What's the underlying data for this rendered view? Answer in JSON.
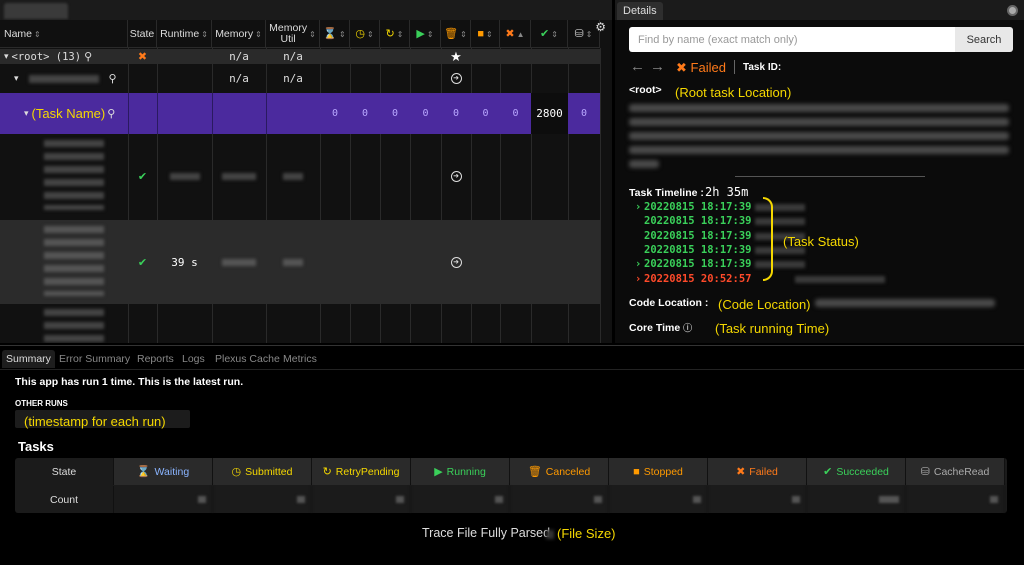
{
  "tree": {
    "columns": [
      {
        "label": "Name",
        "sort": "⇕"
      },
      {
        "label": "State",
        "sort": ""
      },
      {
        "label": "Runtime",
        "sort": "⇕"
      },
      {
        "label": "Memory",
        "sort": "⇕"
      },
      {
        "label": "Memory Util",
        "sort": "⇕"
      },
      {
        "icon": "hourglass-icon",
        "glyph": "⌛",
        "color": "#8ab4ff",
        "sort": "⇕"
      },
      {
        "icon": "clock-icon",
        "glyph": "◷",
        "color": "#f5d800",
        "sort": "⇕"
      },
      {
        "icon": "retry-icon",
        "glyph": "↻",
        "color": "#f5d800",
        "sort": "⇕"
      },
      {
        "icon": "play-icon",
        "glyph": "▶",
        "color": "#3ad05a",
        "sort": "⇕"
      },
      {
        "icon": "trash-icon",
        "glyph": "🗑",
        "color": "#ff9a00",
        "sort": "⇕"
      },
      {
        "icon": "stop-icon",
        "glyph": "■",
        "color": "#ff9a00",
        "sort": "⇕"
      },
      {
        "icon": "x-icon",
        "glyph": "✖",
        "color": "#ff7a1a",
        "sort": "▲"
      },
      {
        "icon": "check-icon",
        "glyph": "✔",
        "color": "#3ad05a",
        "sort": "⇕"
      },
      {
        "icon": "database-icon",
        "glyph": "⛁",
        "color": "#cccccc",
        "sort": "⇕"
      }
    ],
    "root": {
      "label": "<root> (13)",
      "memory": "",
      "memory_util": "n/a",
      "memory_val": "n/a"
    },
    "executor": {
      "memory": "n/a",
      "memory_util": "n/a"
    },
    "selected": {
      "annotation": "(Task Name)",
      "counts": [
        "0",
        "0",
        "0",
        "0",
        "0",
        "0",
        "0",
        "2800",
        "0"
      ]
    },
    "task_row_2": {
      "runtime": "39 s"
    }
  },
  "details": {
    "tab_label": "Details",
    "search_placeholder": "Find by name (exact match only)",
    "search_button": "Search",
    "status": "Failed",
    "task_id_label": "Task ID:",
    "root_label": "<root>",
    "root_annotation": "(Root task Location)",
    "timeline_label": "Task Timeline :",
    "timeline_duration": "2h 35m",
    "timeline": [
      {
        "arrow": "›",
        "time": "20220815 18:17:39",
        "color": "#3ad05a"
      },
      {
        "arrow": "",
        "time": "20220815 18:17:39",
        "color": "#3ad05a"
      },
      {
        "arrow": "",
        "time": "20220815 18:17:39",
        "color": "#3ad05a"
      },
      {
        "arrow": "",
        "time": "20220815 18:17:39",
        "color": "#3ad05a"
      },
      {
        "arrow": "›",
        "time": "20220815 18:17:39",
        "color": "#3ad05a"
      },
      {
        "arrow": "›",
        "time": "20220815 20:52:57",
        "color": "#ff4a2a"
      }
    ],
    "status_annotation": "(Task Status)",
    "code_location_label": "Code Location :",
    "code_location_annotation": "(Code Location)",
    "core_time_label": "Core Time",
    "core_time_annotation": "(Task running Time)"
  },
  "bottom": {
    "tabs": [
      "Summary",
      "Error Summary",
      "Reports",
      "Logs",
      "Plexus Cache",
      "Metrics"
    ],
    "run_message": "This app has run 1 time. This is the latest run.",
    "other_runs_label": "OTHER RUNS",
    "run_timestamp_annotation": "(timestamp for each run)",
    "tasks_title": "Tasks",
    "state_label": "State",
    "count_label": "Count",
    "states": [
      {
        "label": "Waiting",
        "icon": "hourglass-icon",
        "glyph": "⌛",
        "color": "#8ab4ff"
      },
      {
        "label": "Submitted",
        "icon": "clock-icon",
        "glyph": "◷",
        "color": "#f5d800"
      },
      {
        "label": "RetryPending",
        "icon": "retry-icon",
        "glyph": "↻",
        "color": "#f5d800"
      },
      {
        "label": "Running",
        "icon": "play-icon",
        "glyph": "▶",
        "color": "#3ad05a"
      },
      {
        "label": "Canceled",
        "icon": "trash-icon",
        "glyph": "🗑",
        "color": "#ff9a00"
      },
      {
        "label": "Stopped",
        "icon": "stop-icon",
        "glyph": "■",
        "color": "#ff9a00"
      },
      {
        "label": "Failed",
        "icon": "x-icon",
        "glyph": "✖",
        "color": "#ff7a1a"
      },
      {
        "label": "Succeeded",
        "icon": "check-icon",
        "glyph": "✔",
        "color": "#3ad05a"
      },
      {
        "label": "CacheRead",
        "icon": "database-icon",
        "glyph": "⛁",
        "color": "#aaaaaa"
      }
    ],
    "trace_text": "Trace File Fully Parsed",
    "file_size_annotation": "(File Size)"
  },
  "colors": {
    "annotation": "#f5d800",
    "selected_row": "#4b2a9e",
    "failed": "#ff7a1a",
    "success": "#3ad05a"
  }
}
